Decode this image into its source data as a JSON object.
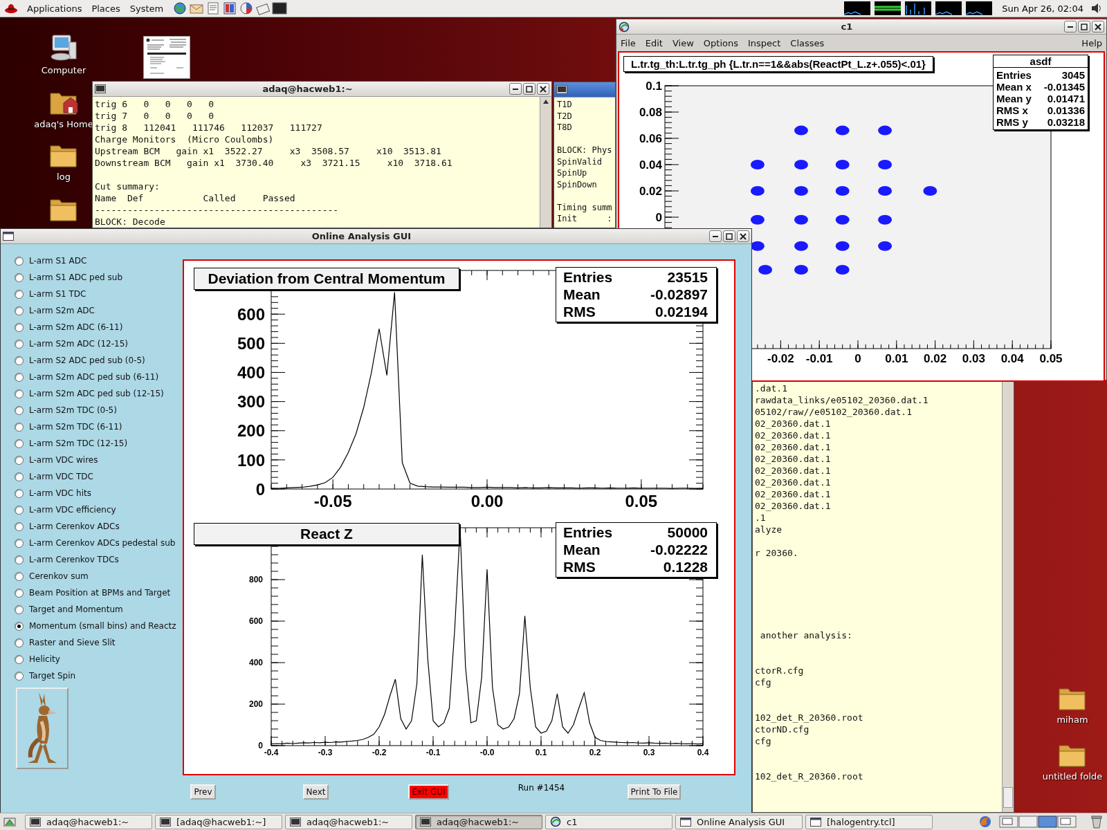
{
  "top_panel": {
    "menus": [
      "Applications",
      "Places",
      "System"
    ],
    "clock": "Sun Apr 26, 02:04"
  },
  "desktop": {
    "left_icons": [
      {
        "label": "Computer",
        "kind": "computer"
      },
      {
        "label": "adaq's Home",
        "kind": "home"
      },
      {
        "label": "log",
        "kind": "folder"
      },
      {
        "kind": "folder"
      }
    ],
    "right_icons": [
      {
        "label": "miham",
        "kind": "folder"
      },
      {
        "label": "untitled folde",
        "kind": "folder"
      }
    ]
  },
  "terminal_1": {
    "title": "adaq@hacweb1:~",
    "text": "trig 6   0   0   0   0\ntrig 7   0   0   0   0\ntrig 8   112041   111746   112037   111727\nCharge Monitors  (Micro Coulombs)\nUpstream BCM   gain x1  3522.27     x3  3508.57     x10  3513.81\nDownstream BCM   gain x1  3730.40     x3  3721.15     x10  3718.61\n\nCut summary:\nName  Def           Called     Passed\n---------------------------------------------\nBLOCK: Decode"
  },
  "terminal_2": {
    "text": "T1D\nT2D\nT8D\n\nBLOCK: Phys\nSpinValid\nSpinUp\nSpinDown\n\nTiming summ\nInit      :"
  },
  "canvas_window": {
    "title": "c1",
    "menu": [
      "File",
      "Edit",
      "View",
      "Options",
      "Inspect",
      "Classes"
    ],
    "help": "Help",
    "stats": {
      "title": "asdf",
      "rows": [
        {
          "label": "Entries",
          "value": "3045"
        },
        {
          "label": "Mean x",
          "value": "-0.01345"
        },
        {
          "label": "Mean y",
          "value": "0.01471"
        },
        {
          "label": "RMS x",
          "value": "0.01336"
        },
        {
          "label": "RMS y",
          "value": "0.03218"
        }
      ]
    },
    "chart_data": {
      "type": "scatter",
      "title": "L.tr.tg_th:L.tr.tg_ph {L.tr.n==1&&abs(ReactPt_L.z+.055)<.01}",
      "x": [
        -0.0147,
        -0.004,
        0.007,
        -0.026,
        -0.0147,
        -0.004,
        0.007,
        -0.026,
        -0.0147,
        -0.004,
        0.007,
        0.0187,
        -0.026,
        -0.0147,
        -0.004,
        0.007,
        -0.026,
        -0.0147,
        -0.004,
        0.007,
        -0.024,
        -0.0147,
        -0.004
      ],
      "series": [
        {
          "color": "#1a1aff",
          "values": [
            0.066,
            0.066,
            0.066,
            0.04,
            0.04,
            0.04,
            0.04,
            0.02,
            0.02,
            0.02,
            0.02,
            0.02,
            -0.002,
            -0.002,
            -0.002,
            -0.002,
            -0.022,
            -0.022,
            -0.022,
            -0.022,
            -0.04,
            -0.04,
            -0.04
          ]
        }
      ],
      "xlim": [
        -0.05,
        0.05
      ],
      "ylim": [
        -0.1,
        0.1
      ],
      "xticks": [
        -0.02,
        -0.01,
        0,
        0.01,
        0.02,
        0.03,
        0.04,
        0.05
      ],
      "yticks": [
        0,
        0.02,
        0.04,
        0.06,
        0.08,
        0.1
      ]
    }
  },
  "terminal_3": {
    "text": ".dat.1\nrawdata_links/e05102_20360.dat.1\n05102/raw//e05102_20360.dat.1\n02_20360.dat.1\n02_20360.dat.1\n02_20360.dat.1\n02_20360.dat.1\n02_20360.dat.1\n02_20360.dat.1\n02_20360.dat.1\n02_20360.dat.1\n.1\nalyze\n\nr 20360.\n\n\n\n\n\n\n another analysis:\n\n\nctorR.cfg\ncfg\n\n\n102_det_R_20360.root\nctorND.cfg\ncfg\n\n\n102_det_R_20360.root"
  },
  "analysis_gui": {
    "title": "Online Analysis GUI",
    "options": [
      {
        "label": "L-arm S1 ADC",
        "selected": false
      },
      {
        "label": "L-arm S1 ADC ped sub",
        "selected": false
      },
      {
        "label": "L-arm S1 TDC",
        "selected": false
      },
      {
        "label": "L-arm S2m ADC",
        "selected": false
      },
      {
        "label": "L-arm S2m ADC (6-11)",
        "selected": false
      },
      {
        "label": "L-arm S2m ADC (12-15)",
        "selected": false
      },
      {
        "label": "L-arm S2 ADC ped sub (0-5)",
        "selected": false
      },
      {
        "label": "L-arm S2m ADC ped sub (6-11)",
        "selected": false
      },
      {
        "label": "L-arm S2m ADC ped sub (12-15)",
        "selected": false
      },
      {
        "label": "L-arm S2m TDC (0-5)",
        "selected": false
      },
      {
        "label": "L-arm S2m TDC (6-11)",
        "selected": false
      },
      {
        "label": "L-arm S2m TDC (12-15)",
        "selected": false
      },
      {
        "label": "L-arm VDC wires",
        "selected": false
      },
      {
        "label": "L-arm VDC TDC",
        "selected": false
      },
      {
        "label": "L-arm VDC hits",
        "selected": false
      },
      {
        "label": "L-arm VDC efficiency",
        "selected": false
      },
      {
        "label": "L-arm Cerenkov ADCs",
        "selected": false
      },
      {
        "label": "L-arm Cerenkov ADCs pedestal sub",
        "selected": false
      },
      {
        "label": "L-arm Cerenkov TDCs",
        "selected": false
      },
      {
        "label": "Cerenkov sum",
        "selected": false
      },
      {
        "label": "Beam Position at BPMs and Target",
        "selected": false
      },
      {
        "label": "Target and Momentum",
        "selected": false
      },
      {
        "label": "Momentum (small bins) and Reactz",
        "selected": true
      },
      {
        "label": "Raster and Sieve Slit",
        "selected": false
      },
      {
        "label": "Helicity",
        "selected": false
      },
      {
        "label": "Target Spin",
        "selected": false
      }
    ],
    "pads": [
      {
        "stats": {
          "rows": [
            {
              "label": "Entries",
              "value": "23515"
            },
            {
              "label": "Mean",
              "value": "-0.02897"
            },
            {
              "label": "RMS",
              "value": "0.02194"
            }
          ]
        },
        "chart_data": {
          "type": "line",
          "title": "Deviation from Central Momentum",
          "x": [
            -0.07,
            -0.0675,
            -0.065,
            -0.0625,
            -0.06,
            -0.0575,
            -0.055,
            -0.0525,
            -0.05,
            -0.0475,
            -0.045,
            -0.0425,
            -0.04,
            -0.0375,
            -0.035,
            -0.0325,
            -0.03,
            -0.0275,
            -0.025,
            -0.0225,
            -0.02,
            -0.0175,
            -0.015,
            -0.0125,
            -0.01,
            -0.0075,
            -0.005,
            -0.0025,
            0,
            0.0025,
            0.005,
            0.0075,
            0.01,
            0.0125,
            0.015,
            0.0175,
            0.02,
            0.0225,
            0.025,
            0.0275,
            0.03,
            0.0325,
            0.035,
            0.0375,
            0.04,
            0.0425,
            0.045,
            0.0475,
            0.05,
            0.0525,
            0.055,
            0.0575,
            0.06,
            0.0625,
            0.065,
            0.0675,
            0.07
          ],
          "series": [
            {
              "color": "#000000",
              "values": [
                3,
                2,
                4,
                5,
                6,
                9,
                14,
                22,
                40,
                75,
                125,
                190,
                280,
                400,
                550,
                390,
                675,
                90,
                20,
                10,
                8,
                7,
                7,
                6,
                6,
                6,
                5,
                5,
                6,
                5,
                5,
                5,
                4,
                5,
                4,
                4,
                5,
                4,
                4,
                4,
                3,
                4,
                4,
                3,
                4,
                3,
                3,
                4,
                3,
                3,
                3,
                3,
                2,
                3,
                3,
                2,
                3
              ]
            }
          ],
          "xlim": [
            -0.07,
            0.07
          ],
          "ylim": [
            0,
            750
          ],
          "xticks": [
            {
              "value": -0.05,
              "label": "-0.05"
            },
            {
              "value": 0,
              "label": "0.00"
            },
            {
              "value": 0.05,
              "label": "0.05"
            }
          ],
          "yticks": [
            0,
            100,
            200,
            300,
            400,
            500,
            600
          ]
        }
      },
      {
        "stats": {
          "rows": [
            {
              "label": "Entries",
              "value": "50000"
            },
            {
              "label": "Mean",
              "value": "-0.02222"
            },
            {
              "label": "RMS",
              "value": "0.1228"
            }
          ]
        },
        "chart_data": {
          "type": "line",
          "title": "React Z",
          "x": [
            -0.4,
            -0.39,
            -0.38,
            -0.37,
            -0.36,
            -0.35,
            -0.34,
            -0.33,
            -0.32,
            -0.31,
            -0.3,
            -0.29,
            -0.28,
            -0.27,
            -0.26,
            -0.25,
            -0.24,
            -0.23,
            -0.22,
            -0.21,
            -0.2,
            -0.19,
            -0.18,
            -0.17,
            -0.16,
            -0.15,
            -0.14,
            -0.13,
            -0.12,
            -0.11,
            -0.1,
            -0.09,
            -0.08,
            -0.07,
            -0.06,
            -0.05,
            -0.04,
            -0.03,
            -0.02,
            -0.01,
            0,
            0.01,
            0.02,
            0.03,
            0.04,
            0.05,
            0.06,
            0.07,
            0.08,
            0.09,
            0.1,
            0.11,
            0.12,
            0.13,
            0.14,
            0.15,
            0.16,
            0.17,
            0.18,
            0.19,
            0.2,
            0.21,
            0.22,
            0.23,
            0.24,
            0.25,
            0.26,
            0.27,
            0.28,
            0.29,
            0.3,
            0.31,
            0.32,
            0.33,
            0.34,
            0.35,
            0.36,
            0.37,
            0.38,
            0.39,
            0.4
          ],
          "series": [
            {
              "color": "#000000",
              "values": [
                8,
                10,
                9,
                12,
                10,
                12,
                14,
                13,
                15,
                14,
                16,
                15,
                18,
                17,
                20,
                22,
                25,
                30,
                40,
                55,
                90,
                150,
                240,
                320,
                130,
                80,
                120,
                300,
                920,
                420,
                120,
                90,
                110,
                180,
                560,
                1050,
                380,
                110,
                120,
                330,
                850,
                280,
                100,
                80,
                90,
                130,
                250,
                625,
                280,
                90,
                60,
                70,
                120,
                250,
                90,
                60,
                100,
                180,
                255,
                110,
                40,
                25,
                20,
                18,
                16,
                15,
                14,
                15,
                13,
                12,
                14,
                12,
                11,
                12,
                10,
                11,
                10,
                9,
                10,
                8,
                9
              ]
            }
          ],
          "xlim": [
            -0.4,
            0.4
          ],
          "ylim": [
            0,
            1050
          ],
          "xticks": [
            -0.4,
            -0.3,
            -0.2,
            -0.1,
            {
              "value": 0,
              "label": "-0.0"
            },
            0.1,
            0.2,
            0.3,
            0.4
          ],
          "yticks": [
            0,
            200,
            400,
            600,
            800
          ]
        }
      }
    ],
    "controls": [
      {
        "label": "Prev",
        "kind": "button"
      },
      {
        "label": "Next",
        "kind": "button"
      },
      {
        "label": "Exit GUI",
        "kind": "danger"
      },
      {
        "label": "Run #1454",
        "kind": "text"
      },
      {
        "label": "Print To File",
        "kind": "button"
      }
    ]
  },
  "taskbar": {
    "items": [
      {
        "label": "adaq@hacweb1:~",
        "kind": "terminal",
        "selected": false
      },
      {
        "label": "[adaq@hacweb1:~]",
        "kind": "terminal",
        "selected": false
      },
      {
        "label": "adaq@hacweb1:~",
        "kind": "terminal",
        "selected": false
      },
      {
        "label": "adaq@hacweb1:~",
        "kind": "terminal",
        "selected": true
      },
      {
        "label": "c1",
        "kind": "canvas",
        "selected": false
      },
      {
        "label": "Online Analysis GUI",
        "kind": "window",
        "selected": false
      },
      {
        "label": "[halogentry.tcl]",
        "kind": "window",
        "selected": false
      }
    ]
  }
}
